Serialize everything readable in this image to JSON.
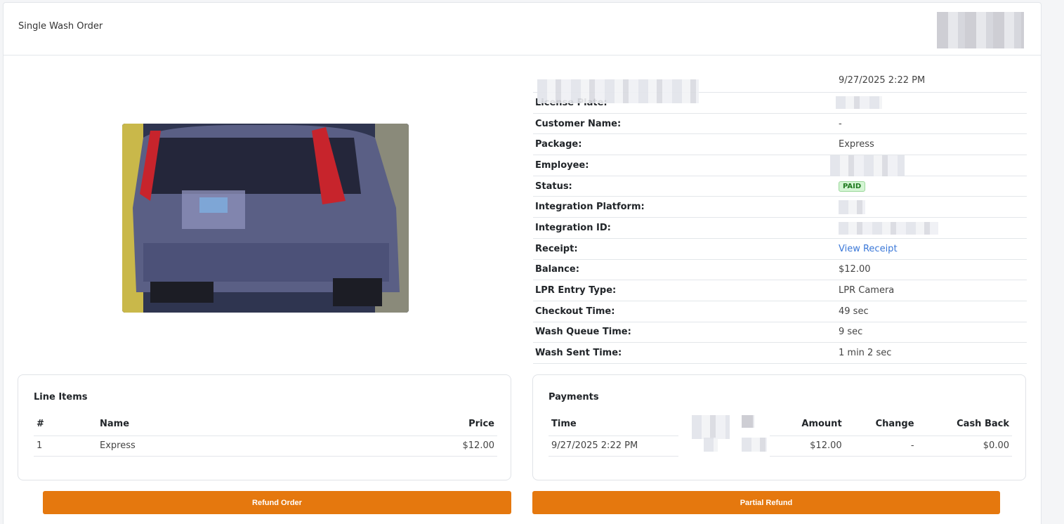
{
  "header": {
    "title": "Single Wash Order"
  },
  "details": {
    "date": "9/27/2025 2:22 PM",
    "rows": [
      {
        "label": "License Plate:",
        "value": ""
      },
      {
        "label": "Customer Name:",
        "value": "-"
      },
      {
        "label": "Package:",
        "value": "Express"
      },
      {
        "label": "Employee:",
        "value": ""
      },
      {
        "label": "Status:",
        "value": "PAID"
      },
      {
        "label": "Integration Platform:",
        "value": ""
      },
      {
        "label": "Integration ID:",
        "value": ""
      },
      {
        "label": "Receipt:",
        "value": "View Receipt"
      },
      {
        "label": "Balance:",
        "value": "$12.00"
      },
      {
        "label": "LPR Entry Type:",
        "value": "LPR Camera"
      },
      {
        "label": "Checkout Time:",
        "value": "49 sec"
      },
      {
        "label": "Wash Queue Time:",
        "value": "9 sec"
      },
      {
        "label": "Wash Sent Time:",
        "value": "1 min 2 sec"
      }
    ]
  },
  "line_items": {
    "title": "Line Items",
    "headers": [
      "#",
      "Name",
      "Price"
    ],
    "rows": [
      {
        "num": "1",
        "name": "Express",
        "price": "$12.00"
      }
    ]
  },
  "payments": {
    "title": "Payments",
    "headers": [
      "Time",
      "Amount",
      "Change",
      "Cash Back"
    ],
    "rows": [
      {
        "time": "9/27/2025 2:22 PM",
        "amount": "$12.00",
        "change": "-",
        "cash_back": "$0.00"
      }
    ]
  },
  "buttons": {
    "refund": "Refund Order",
    "partial_refund": "Partial Refund"
  },
  "colors": {
    "accent": "#e5780e",
    "link": "#3b78d8",
    "paid_badge": "#d4f5d4"
  }
}
